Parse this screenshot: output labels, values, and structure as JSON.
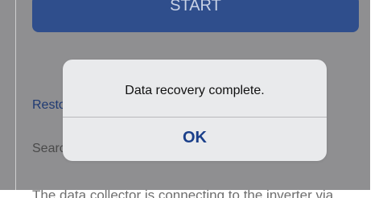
{
  "background": {
    "start_button_label": "START",
    "restore_link": "Restore",
    "search_text": "Search",
    "info_text": "The data collector is connecting to the inverter via"
  },
  "dialog": {
    "message": "Data recovery complete.",
    "ok_label": "OK"
  },
  "colors": {
    "overlay": "#8f8f91",
    "dialog_bg": "#e9eaec",
    "accent": "#1a3f8a",
    "start_button": "#2f4e8c"
  }
}
